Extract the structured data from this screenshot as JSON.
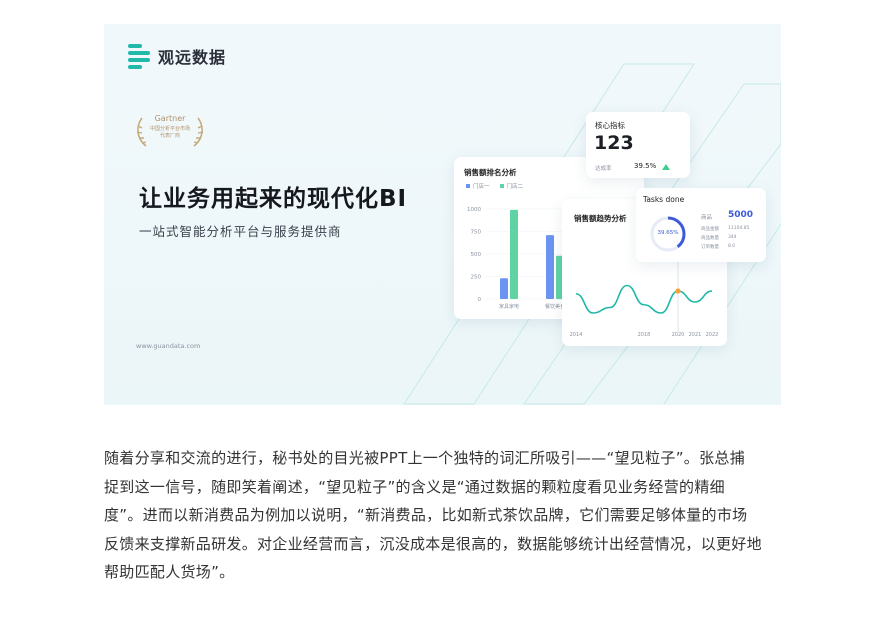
{
  "banner": {
    "logo_text": "观远数据",
    "award": {
      "name": "Gartner",
      "line1": "中国分析平台市场",
      "line2": "代表厂商"
    },
    "headline": "让业务用起来的现代化BI",
    "subline": "一站式智能分析平台与服务提供商",
    "url": "www.guandata.com",
    "colors": {
      "brand": "#21b9a8",
      "bar_a": "#6b93f0",
      "bar_b": "#5fd3a4",
      "line": "#1fb8a8",
      "ring": "#3d5bd9"
    }
  },
  "kpi_card": {
    "title": "核心指标",
    "value": "123",
    "rate_label": "达成率",
    "rate_value": "39.5%",
    "trend_icon": "triangle-up-icon"
  },
  "tasks_card": {
    "title": "Tasks done",
    "ring_value": "39.65%",
    "ring_fraction": 0.3965,
    "rows": [
      {
        "label": "商品",
        "value": "5000"
      },
      {
        "label": "商品金额",
        "value": "11104.85"
      },
      {
        "label": "商品数量",
        "value": "344"
      },
      {
        "label": "订单数量",
        "value": "8.0"
      }
    ]
  },
  "line_card": {
    "title": "销售额趋势分析"
  },
  "bar_card": {
    "title": "销售额排名分析",
    "legend": [
      "门店一",
      "门店二"
    ]
  },
  "chart_data": [
    {
      "type": "bar",
      "title": "销售额排名分析",
      "categories": [
        "家具家电",
        "餐饮美食",
        "爱宠洗护"
      ],
      "series": [
        {
          "name": "门店一",
          "values": [
            230,
            710,
            910
          ]
        },
        {
          "name": "门店二",
          "values": [
            990,
            480,
            260
          ]
        }
      ],
      "yticks": [
        "0",
        "250",
        "500",
        "750",
        "1000"
      ],
      "ylim": [
        0,
        1000
      ]
    },
    {
      "type": "line",
      "title": "销售额趋势分析",
      "x": [
        "2014",
        "2015",
        "2016",
        "2017",
        "2018",
        "2019",
        "2020",
        "2021",
        "2022"
      ],
      "values": [
        55,
        20,
        30,
        70,
        35,
        20,
        60,
        40,
        60
      ],
      "xticks": [
        "2014",
        "2018",
        "2020",
        "2021",
        "2022"
      ],
      "highlight_x": "2020"
    }
  ],
  "article": {
    "lines": [
      "随着分享和交流的进行，秘书处的目光被PPT上一个独特的词汇所吸引——“望见粒子”。张总捕",
      "捉到这一信号，随即笑着阐述，“望见粒子”的含义是“通过数据的颗粒度看见业务经营的精细",
      "度”。进而以新消费品为例加以说明，“新消费品，比如新式茶饮品牌，它们需要足够体量的市场",
      "反馈来支撑新品研发。对企业经营而言，沉没成本是很高的，数据能够统计出经营情况，以更好地",
      "帮助匹配人货场”。"
    ]
  }
}
